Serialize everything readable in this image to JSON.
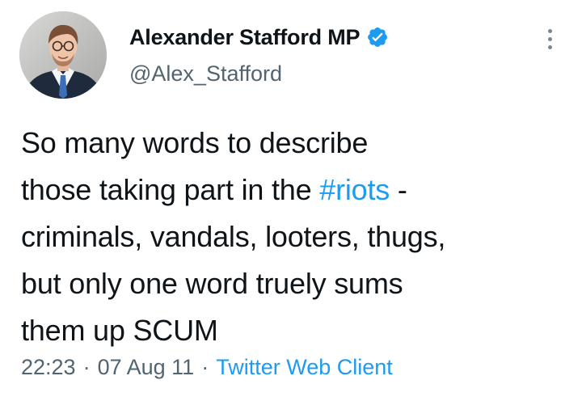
{
  "author": {
    "display_name": "Alexander Stafford MP",
    "handle": "@Alex_Stafford",
    "verified": true,
    "verified_color": "#1d9bf0"
  },
  "tweet": {
    "text_lines": [
      {
        "before": "So many words to describe",
        "hashtag": "",
        "after": ""
      },
      {
        "before": "those taking part in the ",
        "hashtag": "#riots",
        "after": " -"
      },
      {
        "before": "criminals, vandals, looters, thugs,",
        "hashtag": "",
        "after": ""
      },
      {
        "before": "but only one word truely sums",
        "hashtag": "",
        "after": ""
      },
      {
        "before": "them up SCUM",
        "hashtag": "",
        "after": ""
      }
    ]
  },
  "meta": {
    "time": "22:23",
    "separator": "·",
    "date": "07 Aug 11",
    "source": "Twitter Web Client"
  },
  "colors": {
    "text": "#0f1419",
    "secondary": "#536471",
    "link": "#1d9bf0"
  },
  "icons": {
    "verified": "verified-badge-icon",
    "more": "more-options-icon"
  }
}
